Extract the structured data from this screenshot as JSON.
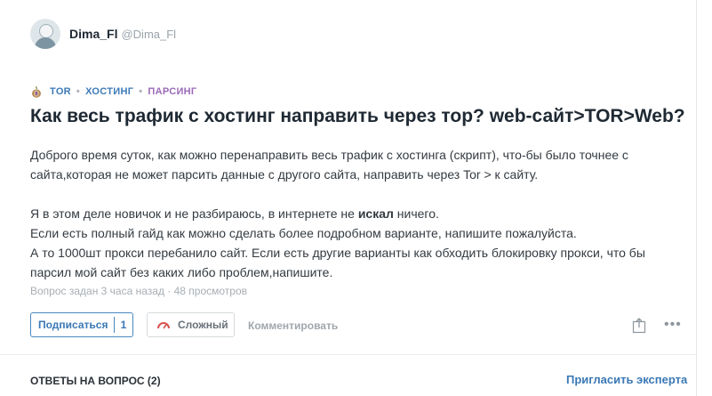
{
  "author": {
    "name": "Dima_Fl",
    "nick": "@Dima_Fl"
  },
  "tags": [
    "TOR",
    "ХОСТИНГ",
    "ПАРСИНГ"
  ],
  "question": {
    "title": "Как весь трафик с хостинг направить через тор? web-сайт>TOR>Web?",
    "p1": "Доброго время суток, как можно перенаправить весь трафик с хостинга (скрипт), что-бы было точнее с",
    "p2": "сайта,которая не может парсить данные с другого сайта, направить через Tor > к сайту.",
    "p3_pre": "Я в этом деле новичок и не разбираюсь, в интернете не ",
    "p3_bold": "искал",
    "p3_post": " ничего.",
    "p4": "Если есть полный гайд как можно сделать более подробном варианте, напишите пожалуйста.",
    "p5": "А то 1000шт прокси перебанило сайт. Если есть другие варианты как обходить блокировку прокси, что бы",
    "p6": "парсил мой сайт без каких либо проблем,напишите.",
    "meta": "Вопрос задан 3 часа назад · 48 просмотров"
  },
  "actions": {
    "subscribe_label": "Подписаться",
    "subscribe_count": "1",
    "difficulty_label": "Сложный",
    "comment_label": "Комментировать",
    "more": "•••"
  },
  "footer": {
    "answers_label": "ОТВЕТЫ НА ВОПРОС (2)",
    "invite_label": "Пригласить эксперта"
  },
  "colors": {
    "accent": "#3a78b5",
    "tag_purple": "#9a6ab8",
    "difficulty": "#d9534f"
  }
}
